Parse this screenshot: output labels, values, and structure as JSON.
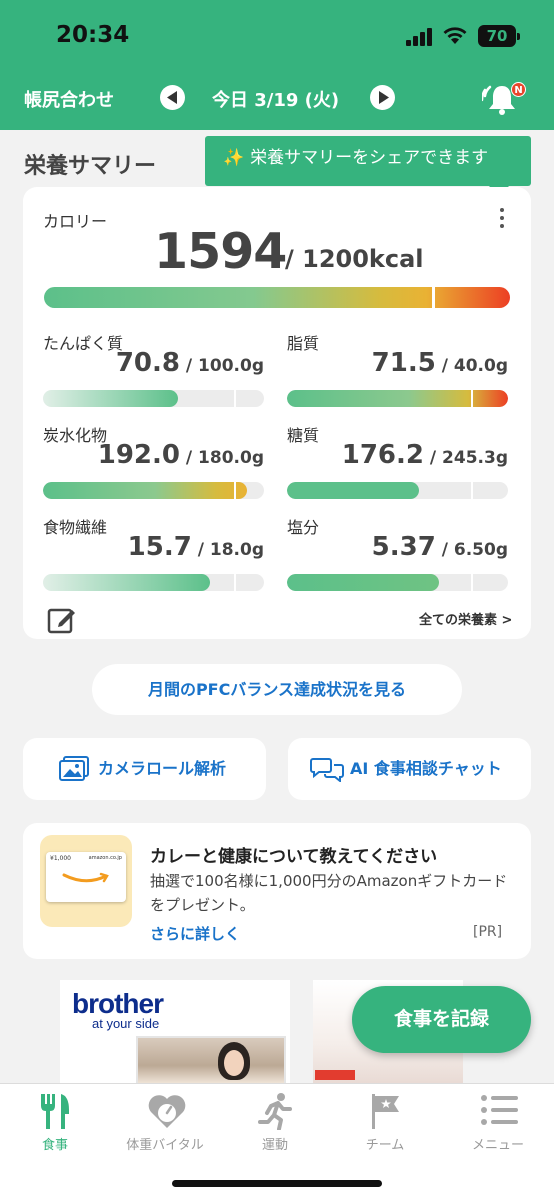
{
  "status_bar": {
    "time": "20:34",
    "battery": "70"
  },
  "header": {
    "left_label": "帳尻合わせ",
    "date": "今日 3/19 (火)",
    "notification_badge": "N"
  },
  "summary": {
    "title": "栄養サマリー",
    "tooltip": "栄養サマリーをシェアできます",
    "calories": {
      "label": "カロリー",
      "value": "1594",
      "target": "/ 1200kcal",
      "ratio": 1.33
    },
    "nutrients": [
      {
        "name": "たんぱく質",
        "value": "70.8",
        "target": " / 100.0g",
        "ratio": 0.708
      },
      {
        "name": "脂質",
        "value": "71.5",
        "target": " / 40.0g",
        "ratio": 1.79
      },
      {
        "name": "炭水化物",
        "value": "192.0",
        "target": " / 180.0g",
        "ratio": 1.067
      },
      {
        "name": "糖質",
        "value": "176.2",
        "target": " / 245.3g",
        "ratio": 0.718
      },
      {
        "name": "食物繊維",
        "value": "15.7",
        "target": " / 18.0g",
        "ratio": 0.872
      },
      {
        "name": "塩分",
        "value": "5.37",
        "target": " / 6.50g",
        "ratio": 0.826
      }
    ],
    "all_nutrients_link": "全ての栄養素 >"
  },
  "pfc_button": "月間のPFCバランス達成状況を見る",
  "actions": {
    "camera_roll": "カメラロール解析",
    "ai_chat": "AI 食事相談チャット"
  },
  "promo": {
    "title": "カレーと健康について教えてください",
    "body": "抽選で100名様に1,000円分のAmazonギフトカード をプレゼント。",
    "link": "さらに詳しく",
    "tag": "[PR]",
    "gift_amount": "¥1,000",
    "gift_brand": "amazon.co.jp"
  },
  "ad": {
    "brand": "brother",
    "tagline": "at your side"
  },
  "fab": "食事を記録",
  "tabs": [
    {
      "label": "食事",
      "icon": "fork-knife-icon",
      "active": true
    },
    {
      "label": "体重バイタル",
      "icon": "heart-scale-icon",
      "active": false
    },
    {
      "label": "運動",
      "icon": "runner-icon",
      "active": false
    },
    {
      "label": "チーム",
      "icon": "flag-icon",
      "active": false
    },
    {
      "label": "メニュー",
      "icon": "list-icon",
      "active": false
    }
  ],
  "colors": {
    "brand_green": "#36b37e",
    "link_blue": "#1a73c9",
    "over_red": "#ec3f24"
  }
}
